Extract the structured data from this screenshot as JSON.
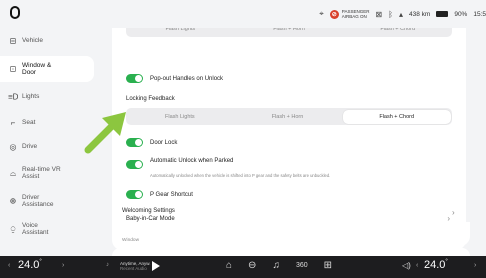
{
  "statusbar": {
    "airbag_label_1": "PASSENGER",
    "airbag_label_2": "AIRBAG ON",
    "range": "438 km",
    "battery": "90%",
    "time": "15:5"
  },
  "sidebar": {
    "items": [
      {
        "label": "Vehicle",
        "icon": "car-icon"
      },
      {
        "label": "Window & Door",
        "icon": "window-door-icon"
      },
      {
        "label": "Lights",
        "icon": "lights-icon"
      },
      {
        "label": "Seat",
        "icon": "seat-icon"
      },
      {
        "label": "Drive",
        "icon": "steering-wheel-icon"
      },
      {
        "label": "Real-time VR Assist",
        "icon": "vr-assist-icon"
      },
      {
        "label": "Driver Assistance",
        "icon": "driver-assist-icon"
      },
      {
        "label": "Voice Assistant",
        "icon": "voice-assistant-icon"
      }
    ],
    "active_index": 1
  },
  "main": {
    "top_segment": [
      "Flash Lights",
      "Flash + Horn",
      "Flash + Chord"
    ],
    "popout_handles_label": "Pop-out Handles on Unlock",
    "locking_feedback_label": "Locking Feedback",
    "locking_feedback_options": [
      "Flash Lights",
      "Flash + Horn",
      "Flash + Chord"
    ],
    "locking_feedback_selected": "Flash + Chord",
    "door_lock_label": "Door Lock",
    "auto_unlock_label": "Automatic Unlock when Parked",
    "auto_unlock_desc": "Automatically unlocked when the vehicle is shifted into P gear and the safety belts are unbuckled.",
    "p_gear_label": "P Gear Shortcut",
    "baby_mode_label": "Baby-in-Car Mode",
    "welcoming_label": "Welcoming Settings",
    "window_section_label": "Window"
  },
  "bottombar": {
    "temp_left": "24.0",
    "temp_right": "24.0",
    "deg": "°",
    "media_title": "Anytime, Anyw.",
    "media_sub": "Recent Audio"
  },
  "colors": {
    "accent_green": "#2ab04f",
    "arrow_green": "#8cc63f"
  }
}
